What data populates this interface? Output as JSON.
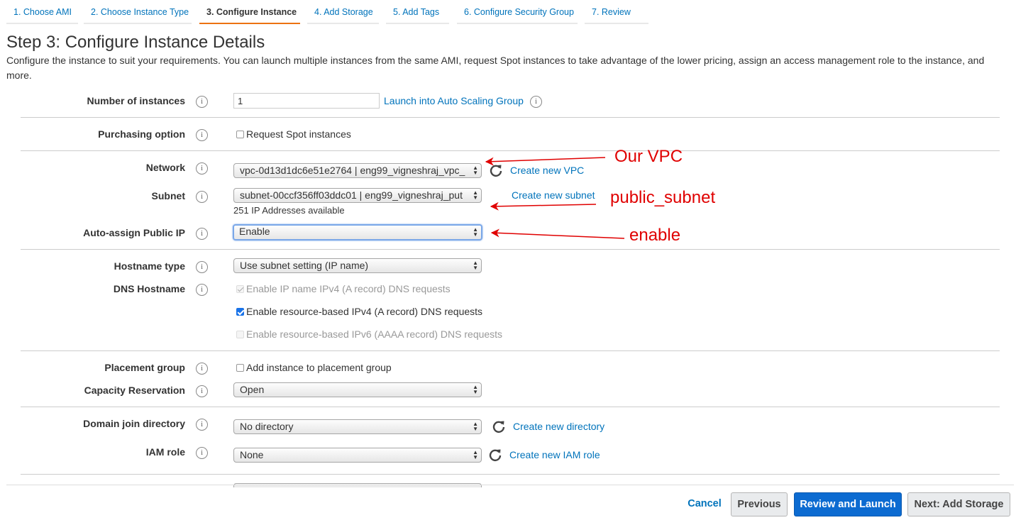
{
  "tabs": [
    {
      "label": "1. Choose AMI"
    },
    {
      "label": "2. Choose Instance Type"
    },
    {
      "label": "3. Configure Instance"
    },
    {
      "label": "4. Add Storage"
    },
    {
      "label": "5. Add Tags"
    },
    {
      "label": "6. Configure Security Group"
    },
    {
      "label": "7. Review"
    }
  ],
  "title": "Step 3: Configure Instance Details",
  "description": "Configure the instance to suit your requirements. You can launch multiple instances from the same AMI, request Spot instances to take advantage of the lower pricing, assign an access management role to the instance, and more.",
  "info_icon": "i",
  "form": {
    "number_of_instances": {
      "label": "Number of instances",
      "value": "1",
      "link": "Launch into Auto Scaling Group"
    },
    "purchasing_option": {
      "label": "Purchasing option",
      "checkbox_label": "Request Spot instances",
      "checked": false
    },
    "network": {
      "label": "Network",
      "value": "vpc-0d13d1dc6e51e2764 | eng99_vigneshraj_vpc_",
      "link": "Create new VPC"
    },
    "subnet": {
      "label": "Subnet",
      "value": "subnet-00ccf356ff03ddc01 | eng99_vigneshraj_put",
      "link": "Create new subnet",
      "note": "251 IP Addresses available"
    },
    "auto_assign_ip": {
      "label": "Auto-assign Public IP",
      "value": "Enable"
    },
    "hostname_type": {
      "label": "Hostname type",
      "value": "Use subnet setting (IP name)"
    },
    "dns_hostname": {
      "label": "DNS Hostname",
      "options": [
        {
          "label": "Enable IP name IPv4 (A record) DNS requests",
          "checked": true,
          "disabled": true
        },
        {
          "label": "Enable resource-based IPv4 (A record) DNS requests",
          "checked": true,
          "disabled": false
        },
        {
          "label": "Enable resource-based IPv6 (AAAA record) DNS requests",
          "checked": false,
          "disabled": true
        }
      ]
    },
    "placement_group": {
      "label": "Placement group",
      "checkbox_label": "Add instance to placement group",
      "checked": false
    },
    "capacity_reservation": {
      "label": "Capacity Reservation",
      "value": "Open"
    },
    "domain_join": {
      "label": "Domain join directory",
      "value": "No directory",
      "link": "Create new directory"
    },
    "iam_role": {
      "label": "IAM role",
      "value": "None",
      "link": "Create new IAM role"
    }
  },
  "annotations": {
    "network": "Our VPC",
    "subnet": "public_subnet",
    "auto_ip": "enable"
  },
  "annotation_color": "#e00000",
  "footer": {
    "cancel": "Cancel",
    "previous": "Previous",
    "review_launch": "Review and Launch",
    "next": "Next: Add Storage"
  },
  "accent_color": "#0073bb",
  "primary_button_color": "#0c6bd1",
  "active_tab_color": "#ec7211"
}
